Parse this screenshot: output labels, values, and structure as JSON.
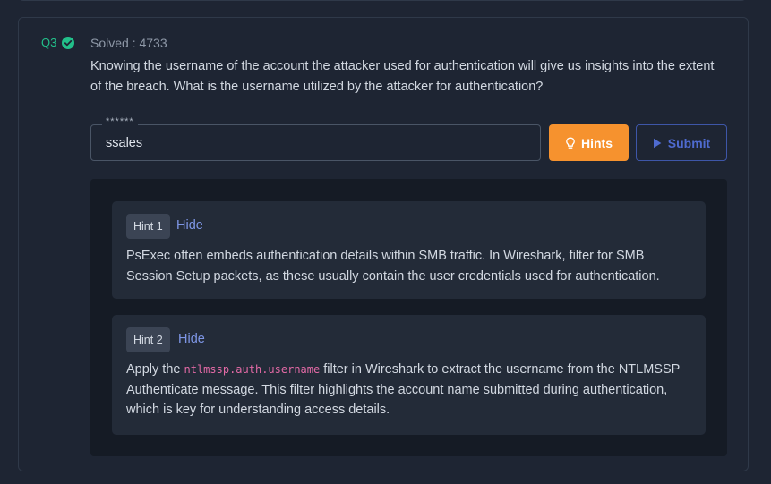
{
  "question": {
    "number": "Q3",
    "status": "solved",
    "solved_label": "Solved : 4733",
    "text": "Knowing the username of the account the attacker used for authentication will give us insights into the extent of the breach. What is the username utilized by the attacker for authentication?"
  },
  "answer": {
    "legend": "******",
    "value": "ssales"
  },
  "buttons": {
    "hints_label": "Hints",
    "submit_label": "Submit"
  },
  "hints": [
    {
      "badge": "Hint 1",
      "toggle_label": "Hide",
      "text": "PsExec often embeds authentication details within SMB traffic. In Wireshark, filter for SMB Session Setup packets, as these usually contain the user credentials used for authentication."
    },
    {
      "badge": "Hint 2",
      "toggle_label": "Hide",
      "text_before": "Apply the ",
      "code": "ntlmssp.auth.username",
      "text_after": " filter in Wireshark to extract the username from the NTLMSSP Authenticate message. This filter highlights the account name submitted during authentication, which is key for understanding access details."
    }
  ],
  "colors": {
    "background": "#1e2533",
    "success": "#22c08a",
    "hints_button": "#f6922e",
    "submit_accent": "#4f6bd0",
    "link": "#7e96e6",
    "code": "#e36aa6"
  },
  "icons": {
    "solved": "check-circle-icon",
    "hints": "lightbulb-icon",
    "submit": "play-icon"
  }
}
